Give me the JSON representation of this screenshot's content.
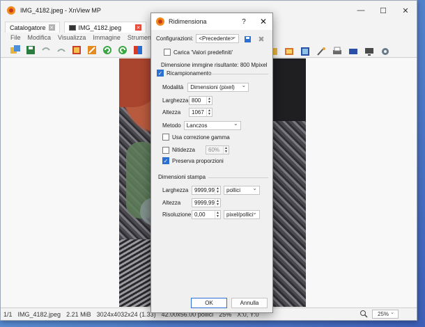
{
  "app": {
    "title": "IMG_4182.jpeg - XnView MP",
    "tabs": [
      {
        "label": "Catalogatore"
      },
      {
        "label": "IMG_4182.jpeg"
      }
    ],
    "menu": [
      "File",
      "Modifica",
      "Visualizza",
      "Immagine",
      "Strumenti"
    ],
    "status": {
      "index": "1/1",
      "filename": "IMG_4182.jpeg",
      "filesize": "2.21 MiB",
      "dimensions": "3024x4032x24 (1.33)",
      "print_size": "42.00x56.00 pollici",
      "zoom_pct": "25%",
      "coords": "X:0, Y:0",
      "zoom_value": "25%"
    }
  },
  "dialog": {
    "title": "Ridimensiona",
    "help": "?",
    "close": "✕",
    "config_label": "Configurazioni:",
    "config_value": "<Precedente>",
    "load_defaults_label": "Carica 'Valori predefiniti'",
    "result_dimension": "Dimensione immgine risultante: 800 Mpixel",
    "resample_label": "Ricampionamento",
    "mode_label": "Modalità",
    "mode_value": "Dimensioni (pixel)",
    "width_label": "Larghezza",
    "width_value": "800",
    "height_label": "Altezza",
    "height_value": "1067",
    "method_label": "Metodo",
    "method_value": "Lanczos",
    "gamma_label": "Usa correzione gamma",
    "sharpness_label": "Nitidezza",
    "sharpness_value": "60%",
    "preserve_label": "Preserva proporzioni",
    "print_section": "Dimensioni stampa",
    "print_width_label": "Larghezza",
    "print_width_value": "9999,99",
    "print_width_unit": "pollici",
    "print_height_label": "Altezza",
    "print_height_value": "9999,99",
    "resolution_label": "Risoluzione",
    "resolution_value": "0,00",
    "resolution_unit": "pixel/pollici",
    "ok_label": "OK",
    "cancel_label": "Annulla",
    "load_defaults_checked": false,
    "resample_checked": true,
    "gamma_checked": false,
    "sharpness_checked": false,
    "preserve_checked": true
  },
  "colors": {
    "accent": "#2a6fd1",
    "tab_close_red": "#e64b3b"
  }
}
